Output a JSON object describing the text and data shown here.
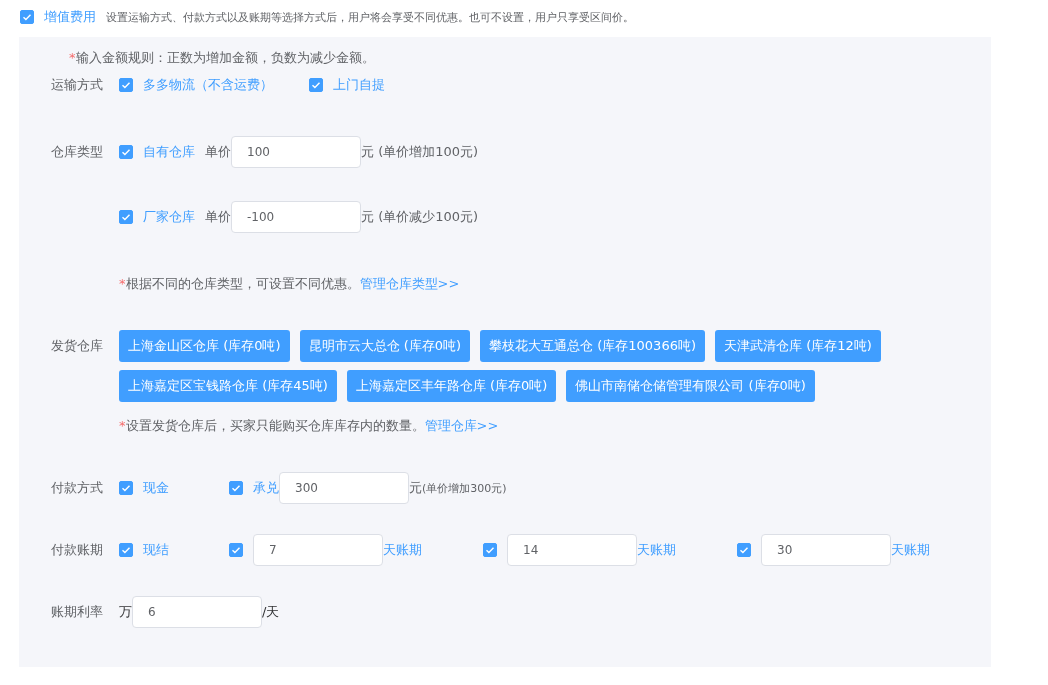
{
  "header": {
    "checked": true,
    "label": "增值费用",
    "description": "设置运输方式、付款方式以及账期等选择方式后，用户将会享受不同优惠。也可不设置，用户只享受区间价。"
  },
  "rule_note": {
    "mark": "*",
    "text": "输入金额规则：正数为增加金额，负数为减少金额。"
  },
  "shipping": {
    "label": "运输方式",
    "options": [
      {
        "checked": true,
        "label": "多多物流（不含运费）"
      },
      {
        "checked": true,
        "label": "上门自提"
      }
    ]
  },
  "warehouse_type": {
    "label": "仓库类型",
    "items": [
      {
        "checked": true,
        "label": "自有仓库",
        "price_label": "单价",
        "value": "100",
        "unit": "元",
        "note": "(单价增加100元)"
      },
      {
        "checked": true,
        "label": "厂家仓库",
        "price_label": "单价",
        "value": "-100",
        "unit": "元",
        "note": "(单价减少100元)"
      }
    ],
    "note": {
      "mark": "*",
      "text": "根据不同的仓库类型，可设置不同优惠。",
      "link": "管理仓库类型>>"
    }
  },
  "dispatch": {
    "label": "发货仓库",
    "tags": [
      "上海金山区仓库 (库存0吨)",
      "昆明市云大总仓 (库存0吨)",
      "攀枝花大互通总仓 (库存100366吨)",
      "天津武清仓库 (库存12吨)",
      "上海嘉定区宝钱路仓库 (库存45吨)",
      "上海嘉定区丰年路仓库 (库存0吨)",
      "佛山市南储仓储管理有限公司 (库存0吨)"
    ],
    "note": {
      "mark": "*",
      "text": "设置发货仓库后，买家只能购买仓库库存内的数量。",
      "link": "管理仓库>>"
    }
  },
  "payment": {
    "label": "付款方式",
    "options": [
      {
        "kind": "plain",
        "checked": true,
        "label": "现金"
      },
      {
        "kind": "input",
        "checked": true,
        "label": "承兑",
        "value": "300",
        "unit": "元",
        "note": "(单价增加300元)"
      }
    ]
  },
  "term": {
    "label": "付款账期",
    "options": [
      {
        "kind": "plain",
        "checked": true,
        "label": "现结"
      },
      {
        "kind": "input",
        "checked": true,
        "value": "7",
        "suffix": "天账期"
      },
      {
        "kind": "input",
        "checked": true,
        "value": "14",
        "suffix": "天账期"
      },
      {
        "kind": "input",
        "checked": true,
        "value": "30",
        "suffix": "天账期"
      }
    ]
  },
  "rate": {
    "label": "账期利率",
    "prefix": "万",
    "value": "6",
    "suffix": "/天"
  }
}
